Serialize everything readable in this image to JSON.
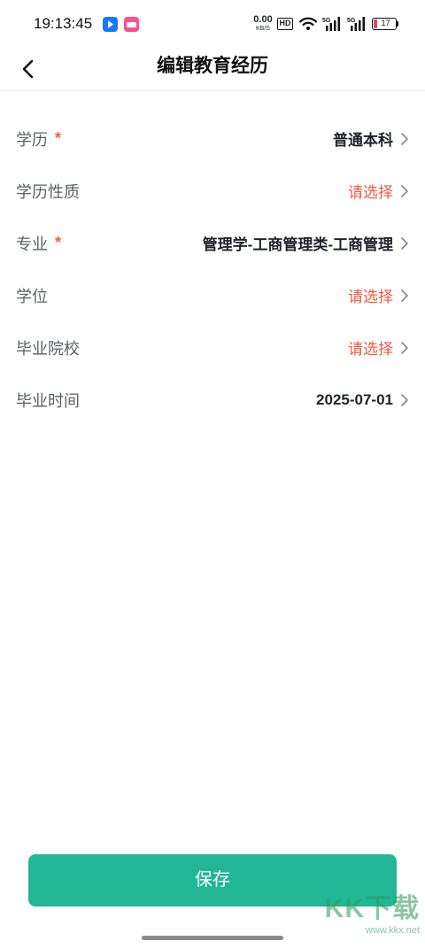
{
  "status_bar": {
    "time": "19:13:45",
    "net_speed_value": "0.00",
    "net_speed_unit": "KB/S",
    "hd_label": "HD",
    "signal_label_1": "5G",
    "signal_label_2": "5G",
    "battery_level": "17",
    "battery_color": "#e5484d"
  },
  "nav": {
    "back_icon": "chevron-left-icon",
    "title": "编辑教育经历"
  },
  "form": {
    "rows": [
      {
        "label": "学历",
        "required": "*",
        "value": "普通本科",
        "is_placeholder": false
      },
      {
        "label": "学历性质",
        "required": "",
        "value": "请选择",
        "is_placeholder": true
      },
      {
        "label": "专业",
        "required": "*",
        "value": "管理学-工商管理类-工商管理",
        "is_placeholder": false
      },
      {
        "label": "学位",
        "required": "",
        "value": "请选择",
        "is_placeholder": true
      },
      {
        "label": "毕业院校",
        "required": "",
        "value": "请选择",
        "is_placeholder": true
      },
      {
        "label": "毕业时间",
        "required": "",
        "value": "2025-07-01",
        "is_placeholder": false
      }
    ]
  },
  "save_button": {
    "label": "保存",
    "color": "#21b794"
  },
  "watermark": {
    "logo": "KK下载",
    "site": "www.kkx.net"
  },
  "colors": {
    "accent": "#21b794",
    "required": "#ff5a3c",
    "placeholder": "#f0593e"
  }
}
